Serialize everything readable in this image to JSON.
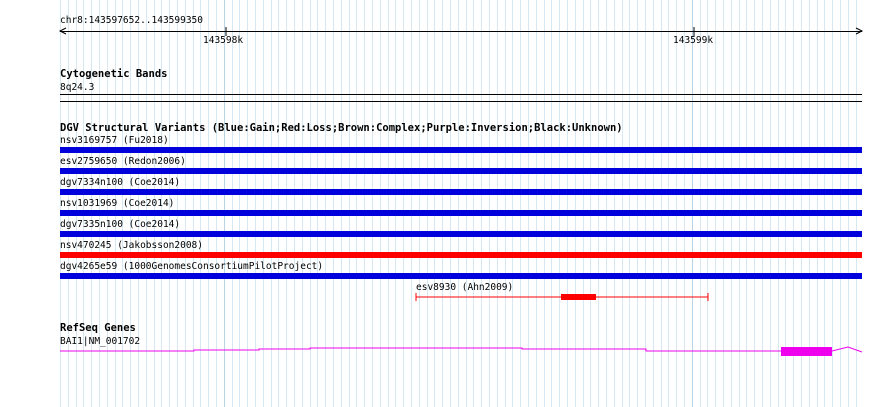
{
  "ruler": {
    "region_label": "chr8:143597652..143599350",
    "ticks": [
      {
        "label": "143598k",
        "position": 143598000
      },
      {
        "label": "143599k",
        "position": 143599000
      }
    ]
  },
  "region": {
    "start": 143597652,
    "end": 143599350
  },
  "cytoband_track": {
    "title": "Cytogenetic Bands",
    "band_label": "8q24.3"
  },
  "dgv_track": {
    "title": "DGV Structural Variants (Blue:Gain;Red:Loss;Brown:Complex;Purple:Inversion;Black:Unknown)",
    "colors": {
      "gain": "#0000dd",
      "loss": "#ff0000"
    },
    "features": [
      {
        "label": "nsv3169757 (Fu2018)",
        "type": "gain"
      },
      {
        "label": "esv2759650 (Redon2006)",
        "type": "gain"
      },
      {
        "label": "dgv7334n100 (Coe2014)",
        "type": "gain"
      },
      {
        "label": "nsv1031969 (Coe2014)",
        "type": "gain"
      },
      {
        "label": "dgv7335n100 (Coe2014)",
        "type": "gain"
      },
      {
        "label": "nsv470245 (Jakobsson2008)",
        "type": "loss"
      },
      {
        "label": "dgv4265e59 (1000GenomesConsortiumPilotProject)",
        "type": "gain"
      }
    ],
    "partial_feature": {
      "label": "esv8930 (Ahn2009)",
      "type": "loss"
    }
  },
  "refseq_track": {
    "title": "RefSeq Genes",
    "gene_label": "BAI1|NM_001702",
    "color": "#ee00ee"
  }
}
